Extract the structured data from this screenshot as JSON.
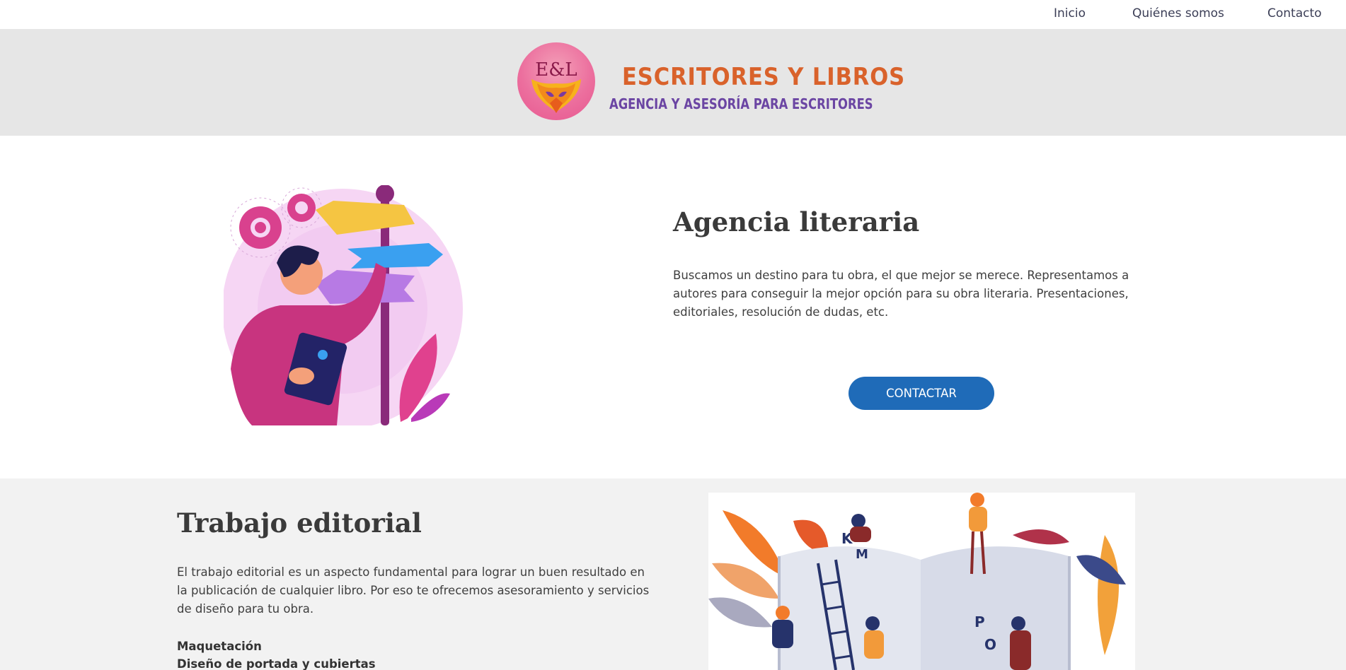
{
  "nav": {
    "items": [
      "Inicio",
      "Quiénes somos",
      "Contacto"
    ]
  },
  "header": {
    "logo_monogram": "E&L",
    "title": "ESCRITORES Y LIBROS",
    "subtitle": "AGENCIA Y ASESORÍA PARA ESCRITORES"
  },
  "agency": {
    "title": "Agencia literaria",
    "paragraph": "Buscamos un destino para tu obra, el que mejor se merece. Representamos a autores para conseguir la mejor opción para su obra literaria. Presentaciones, editoriales, resolución de dudas, etc.",
    "button_label": "CONTACTAR"
  },
  "editorial": {
    "title": "Trabajo editorial",
    "paragraph": "El trabajo editorial es un aspecto fundamental para lograr un buen resultado en la publicación de cualquier libro. Por eso te ofrecemos asesoramiento y servicios de diseño para tu obra.",
    "services": [
      "Maquetación",
      "Diseño de portada y cubiertas"
    ]
  },
  "colors": {
    "accent_button": "#1f6bb8",
    "header_bg": "#e6e6e6",
    "logo_title": "#d9622b",
    "logo_subtitle": "#6b45a3"
  }
}
